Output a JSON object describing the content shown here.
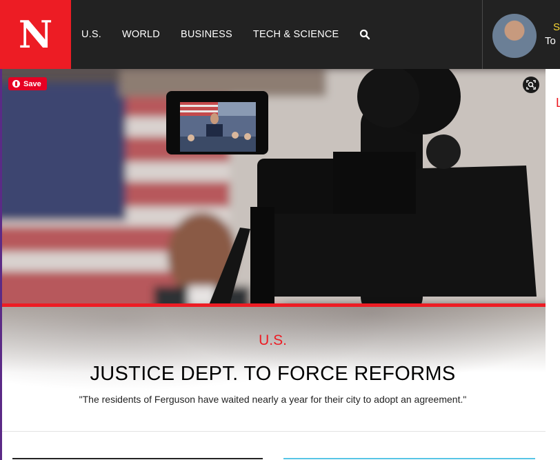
{
  "header": {
    "logo_letter": "N",
    "nav": [
      "U.S.",
      "WORLD",
      "BUSINESS",
      "TECH & SCIENCE"
    ],
    "promo_line1": "S",
    "promo_line2": "To"
  },
  "hero": {
    "pin_label": "Save"
  },
  "article": {
    "section": "U.S.",
    "headline": "JUSTICE DEPT. TO FORCE REFORMS",
    "dek": "\"The residents of Ferguson have waited nearly a year for their city to adopt an agreement.\""
  },
  "sidebar": {
    "partial_letter": "L"
  },
  "colors": {
    "brand_red": "#ed1c24",
    "header_bg": "#222222",
    "promo_yellow": "#f7d633",
    "card_accent": "#56c5e6"
  }
}
